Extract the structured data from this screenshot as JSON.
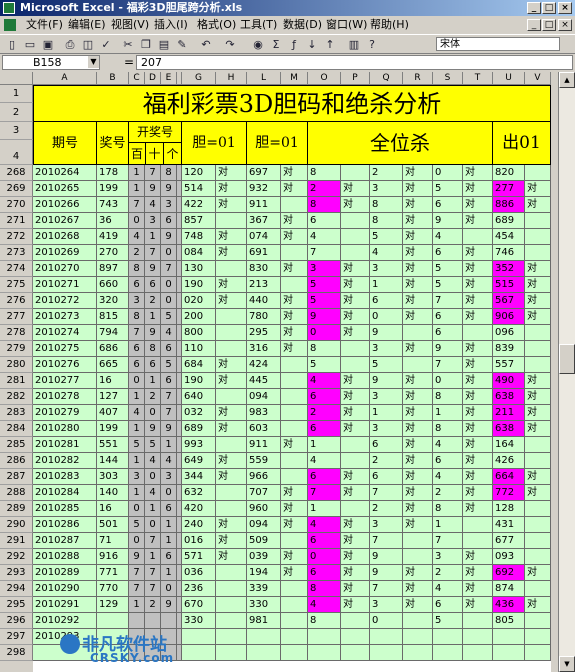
{
  "window": {
    "title": "Microsoft Excel - 福彩3D胆尾跨分析.xls"
  },
  "menu": {
    "items": [
      "文件(F)",
      "编辑(E)",
      "视图(V)",
      "插入(I)",
      "格式(O)",
      "工具(T)",
      "数据(D)",
      "窗口(W)",
      "帮助(H)"
    ]
  },
  "toolbar": {
    "font_name": "宋体"
  },
  "formula_bar": {
    "name_box": "B158",
    "eq": "=",
    "value": "207"
  },
  "columns": [
    "A",
    "B",
    "C",
    "D",
    "E",
    "G",
    "H",
    "L",
    "M",
    "O",
    "P",
    "Q",
    "R",
    "S",
    "T",
    "U",
    "V"
  ],
  "sheet": {
    "banner": "福利彩票3D胆码和绝杀分析",
    "header": {
      "period": "期号",
      "prize": "奖号",
      "open": "开奖号",
      "hundred": "百",
      "ten": "十",
      "unit": "个",
      "dan1": "胆=01",
      "dan2": "胆=01",
      "kill": "全位杀",
      "out": "出01"
    },
    "header_row_numbers": [
      "1",
      "2",
      "3",
      "4"
    ],
    "rows": [
      {
        "n": "268",
        "p": "2010264",
        "v": "178",
        "d": [
          "1",
          "7",
          "8"
        ],
        "g": "120",
        "h": "对",
        "l": "697",
        "m": "对",
        "o": "8",
        "op": false,
        "pm": "",
        "q": "2",
        "r": "对",
        "s": "0",
        "t": "对",
        "u": "820",
        "up": false,
        "vm": ""
      },
      {
        "n": "269",
        "p": "2010265",
        "v": "199",
        "d": [
          "1",
          "9",
          "9"
        ],
        "g": "514",
        "h": "对",
        "l": "932",
        "m": "对",
        "o": "2",
        "op": true,
        "pm": "对",
        "q": "3",
        "r": "对",
        "s": "5",
        "t": "对",
        "u": "277",
        "up": true,
        "vm": "对"
      },
      {
        "n": "270",
        "p": "2010266",
        "v": "743",
        "d": [
          "7",
          "4",
          "3"
        ],
        "g": "422",
        "h": "对",
        "l": "911",
        "m": "",
        "o": "8",
        "op": true,
        "pm": "对",
        "q": "8",
        "r": "对",
        "s": "6",
        "t": "对",
        "u": "886",
        "up": true,
        "vm": "对"
      },
      {
        "n": "271",
        "p": "2010267",
        "v": "36",
        "d": [
          "0",
          "3",
          "6"
        ],
        "g": "857",
        "h": "",
        "l": "367",
        "m": "对",
        "o": "6",
        "op": false,
        "pm": "",
        "q": "8",
        "r": "对",
        "s": "9",
        "t": "对",
        "u": "689",
        "up": false,
        "vm": ""
      },
      {
        "n": "272",
        "p": "2010268",
        "v": "419",
        "d": [
          "4",
          "1",
          "9"
        ],
        "g": "748",
        "h": "对",
        "l": "074",
        "m": "对",
        "o": "4",
        "op": false,
        "pm": "",
        "q": "5",
        "r": "对",
        "s": "4",
        "t": "",
        "u": "454",
        "up": false,
        "vm": ""
      },
      {
        "n": "273",
        "p": "2010269",
        "v": "270",
        "d": [
          "2",
          "7",
          "0"
        ],
        "g": "084",
        "h": "对",
        "l": "691",
        "m": "",
        "o": "7",
        "op": false,
        "pm": "",
        "q": "4",
        "r": "对",
        "s": "6",
        "t": "对",
        "u": "746",
        "up": false,
        "vm": ""
      },
      {
        "n": "274",
        "p": "2010270",
        "v": "897",
        "d": [
          "8",
          "9",
          "7"
        ],
        "g": "130",
        "h": "",
        "l": "830",
        "m": "对",
        "o": "3",
        "op": true,
        "pm": "对",
        "q": "3",
        "r": "对",
        "s": "5",
        "t": "对",
        "u": "352",
        "up": true,
        "vm": "对"
      },
      {
        "n": "275",
        "p": "2010271",
        "v": "660",
        "d": [
          "6",
          "6",
          "0"
        ],
        "g": "190",
        "h": "对",
        "l": "213",
        "m": "",
        "o": "5",
        "op": true,
        "pm": "对",
        "q": "1",
        "r": "对",
        "s": "5",
        "t": "对",
        "u": "515",
        "up": true,
        "vm": "对"
      },
      {
        "n": "276",
        "p": "2010272",
        "v": "320",
        "d": [
          "3",
          "2",
          "0"
        ],
        "g": "020",
        "h": "对",
        "l": "440",
        "m": "对",
        "o": "5",
        "op": true,
        "pm": "对",
        "q": "6",
        "r": "对",
        "s": "7",
        "t": "对",
        "u": "567",
        "up": true,
        "vm": "对"
      },
      {
        "n": "277",
        "p": "2010273",
        "v": "815",
        "d": [
          "8",
          "1",
          "5"
        ],
        "g": "200",
        "h": "",
        "l": "780",
        "m": "对",
        "o": "9",
        "op": true,
        "pm": "对",
        "q": "0",
        "r": "对",
        "s": "6",
        "t": "对",
        "u": "906",
        "up": true,
        "vm": "对"
      },
      {
        "n": "278",
        "p": "2010274",
        "v": "794",
        "d": [
          "7",
          "9",
          "4"
        ],
        "g": "800",
        "h": "",
        "l": "295",
        "m": "对",
        "o": "0",
        "op": true,
        "pm": "对",
        "q": "9",
        "r": "",
        "s": "6",
        "t": "",
        "u": "096",
        "up": false,
        "vm": ""
      },
      {
        "n": "279",
        "p": "2010275",
        "v": "686",
        "d": [
          "6",
          "8",
          "6"
        ],
        "g": "110",
        "h": "",
        "l": "316",
        "m": "对",
        "o": "8",
        "op": false,
        "pm": "",
        "q": "3",
        "r": "对",
        "s": "9",
        "t": "对",
        "u": "839",
        "up": false,
        "vm": ""
      },
      {
        "n": "280",
        "p": "2010276",
        "v": "665",
        "d": [
          "6",
          "6",
          "5"
        ],
        "g": "684",
        "h": "对",
        "l": "424",
        "m": "",
        "o": "5",
        "op": false,
        "pm": "",
        "q": "5",
        "r": "",
        "s": "7",
        "t": "对",
        "u": "557",
        "up": false,
        "vm": ""
      },
      {
        "n": "281",
        "p": "2010277",
        "v": "16",
        "d": [
          "0",
          "1",
          "6"
        ],
        "g": "190",
        "h": "对",
        "l": "445",
        "m": "",
        "o": "4",
        "op": true,
        "pm": "对",
        "q": "9",
        "r": "对",
        "s": "0",
        "t": "对",
        "u": "490",
        "up": true,
        "vm": "对"
      },
      {
        "n": "282",
        "p": "2010278",
        "v": "127",
        "d": [
          "1",
          "2",
          "7"
        ],
        "g": "640",
        "h": "",
        "l": "094",
        "m": "",
        "o": "6",
        "op": true,
        "pm": "对",
        "q": "3",
        "r": "对",
        "s": "8",
        "t": "对",
        "u": "638",
        "up": true,
        "vm": "对"
      },
      {
        "n": "283",
        "p": "2010279",
        "v": "407",
        "d": [
          "4",
          "0",
          "7"
        ],
        "g": "032",
        "h": "对",
        "l": "983",
        "m": "",
        "o": "2",
        "op": true,
        "pm": "对",
        "q": "1",
        "r": "对",
        "s": "1",
        "t": "对",
        "u": "211",
        "up": true,
        "vm": "对"
      },
      {
        "n": "284",
        "p": "2010280",
        "v": "199",
        "d": [
          "1",
          "9",
          "9"
        ],
        "g": "689",
        "h": "对",
        "l": "603",
        "m": "",
        "o": "6",
        "op": true,
        "pm": "对",
        "q": "3",
        "r": "对",
        "s": "8",
        "t": "对",
        "u": "638",
        "up": true,
        "vm": "对"
      },
      {
        "n": "285",
        "p": "2010281",
        "v": "551",
        "d": [
          "5",
          "5",
          "1"
        ],
        "g": "993",
        "h": "",
        "l": "911",
        "m": "对",
        "o": "1",
        "op": false,
        "pm": "",
        "q": "6",
        "r": "对",
        "s": "4",
        "t": "对",
        "u": "164",
        "up": false,
        "vm": ""
      },
      {
        "n": "286",
        "p": "2010282",
        "v": "144",
        "d": [
          "1",
          "4",
          "4"
        ],
        "g": "649",
        "h": "对",
        "l": "559",
        "m": "",
        "o": "4",
        "op": false,
        "pm": "",
        "q": "2",
        "r": "对",
        "s": "6",
        "t": "对",
        "u": "426",
        "up": false,
        "vm": ""
      },
      {
        "n": "287",
        "p": "2010283",
        "v": "303",
        "d": [
          "3",
          "0",
          "3"
        ],
        "g": "344",
        "h": "对",
        "l": "966",
        "m": "",
        "o": "6",
        "op": true,
        "pm": "对",
        "q": "6",
        "r": "对",
        "s": "4",
        "t": "对",
        "u": "664",
        "up": true,
        "vm": "对"
      },
      {
        "n": "288",
        "p": "2010284",
        "v": "140",
        "d": [
          "1",
          "4",
          "0"
        ],
        "g": "632",
        "h": "",
        "l": "707",
        "m": "对",
        "o": "7",
        "op": true,
        "pm": "对",
        "q": "7",
        "r": "对",
        "s": "2",
        "t": "对",
        "u": "772",
        "up": true,
        "vm": "对"
      },
      {
        "n": "289",
        "p": "2010285",
        "v": "16",
        "d": [
          "0",
          "1",
          "6"
        ],
        "g": "420",
        "h": "",
        "l": "960",
        "m": "对",
        "o": "1",
        "op": false,
        "pm": "",
        "q": "2",
        "r": "对",
        "s": "8",
        "t": "对",
        "u": "128",
        "up": false,
        "vm": ""
      },
      {
        "n": "290",
        "p": "2010286",
        "v": "501",
        "d": [
          "5",
          "0",
          "1"
        ],
        "g": "240",
        "h": "对",
        "l": "094",
        "m": "对",
        "o": "4",
        "op": true,
        "pm": "对",
        "q": "3",
        "r": "对",
        "s": "1",
        "t": "",
        "u": "431",
        "up": false,
        "vm": ""
      },
      {
        "n": "291",
        "p": "2010287",
        "v": "71",
        "d": [
          "0",
          "7",
          "1"
        ],
        "g": "016",
        "h": "对",
        "l": "509",
        "m": "",
        "o": "6",
        "op": true,
        "pm": "对",
        "q": "7",
        "r": "",
        "s": "7",
        "t": "",
        "u": "677",
        "up": false,
        "vm": ""
      },
      {
        "n": "292",
        "p": "2010288",
        "v": "916",
        "d": [
          "9",
          "1",
          "6"
        ],
        "g": "571",
        "h": "对",
        "l": "039",
        "m": "对",
        "o": "0",
        "op": true,
        "pm": "对",
        "q": "9",
        "r": "",
        "s": "3",
        "t": "对",
        "u": "093",
        "up": false,
        "vm": ""
      },
      {
        "n": "293",
        "p": "2010289",
        "v": "771",
        "d": [
          "7",
          "7",
          "1"
        ],
        "g": "036",
        "h": "",
        "l": "194",
        "m": "对",
        "o": "6",
        "op": true,
        "pm": "对",
        "q": "9",
        "r": "对",
        "s": "2",
        "t": "对",
        "u": "692",
        "up": true,
        "vm": "对"
      },
      {
        "n": "294",
        "p": "2010290",
        "v": "770",
        "d": [
          "7",
          "7",
          "0"
        ],
        "g": "236",
        "h": "",
        "l": "339",
        "m": "",
        "o": "8",
        "op": true,
        "pm": "对",
        "q": "7",
        "r": "对",
        "s": "4",
        "t": "对",
        "u": "874",
        "up": false,
        "vm": ""
      },
      {
        "n": "295",
        "p": "2010291",
        "v": "129",
        "d": [
          "1",
          "2",
          "9"
        ],
        "g": "670",
        "h": "",
        "l": "330",
        "m": "",
        "o": "4",
        "op": true,
        "pm": "对",
        "q": "3",
        "r": "对",
        "s": "6",
        "t": "对",
        "u": "436",
        "up": true,
        "vm": "对"
      },
      {
        "n": "296",
        "p": "2010292",
        "v": "",
        "d": [
          "",
          "",
          ""
        ],
        "g": "330",
        "h": "",
        "l": "981",
        "m": "",
        "o": "8",
        "op": false,
        "pm": "",
        "q": "0",
        "r": "",
        "s": "5",
        "t": "",
        "u": "805",
        "up": false,
        "vm": ""
      },
      {
        "n": "297",
        "p": "2010293",
        "v": "",
        "d": [
          "",
          "",
          ""
        ],
        "g": "",
        "h": "",
        "l": "",
        "m": "",
        "o": "",
        "op": false,
        "pm": "",
        "q": "",
        "r": "",
        "s": "",
        "t": "",
        "u": "",
        "up": false,
        "vm": ""
      },
      {
        "n": "298",
        "p": "",
        "v": "",
        "d": [
          "",
          "",
          ""
        ],
        "g": "",
        "h": "",
        "l": "",
        "m": "",
        "o": "",
        "op": false,
        "pm": "",
        "q": "",
        "r": "",
        "s": "",
        "t": "",
        "u": "",
        "up": false,
        "vm": ""
      }
    ]
  },
  "watermark": {
    "line1": "非凡软件站",
    "line2": "CRSKY.com"
  },
  "colors": {
    "banner": "#ffff00",
    "cell_green": "#ccffcc",
    "highlight": "#ff00ff",
    "digit_gray": "#c0c0c0"
  }
}
